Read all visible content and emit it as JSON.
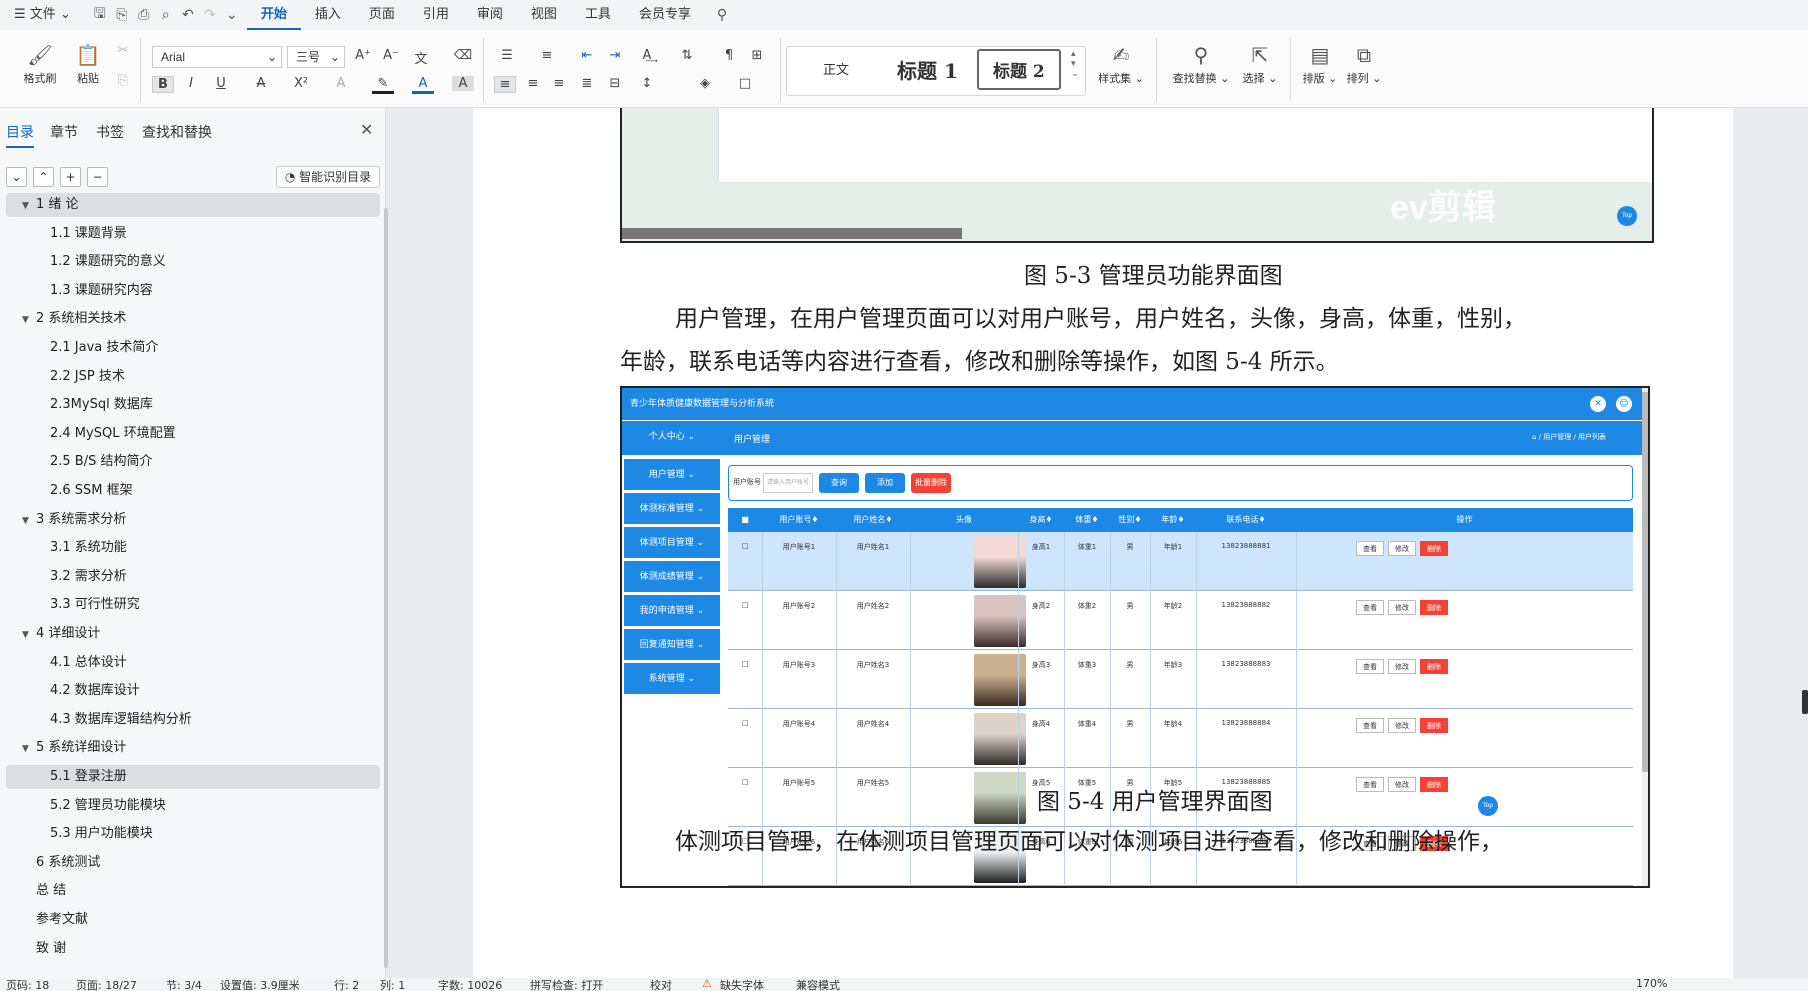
{
  "menu": {
    "file": "文件",
    "items": [
      "开始",
      "插入",
      "页面",
      "引用",
      "审阅",
      "视图",
      "工具",
      "会员专享"
    ]
  },
  "ribbon": {
    "format_painter": "格式刷",
    "paste": "粘贴",
    "font_name": "Arial",
    "font_size": "三号",
    "style_normal": "正文",
    "style_h1": "标题 1",
    "style_h2": "标题 2",
    "style_set": "样式集",
    "find_replace": "查找替换",
    "select": "选择",
    "layout": "排版",
    "arrange": "排列"
  },
  "sidebar": {
    "tabs": [
      "目录",
      "章节",
      "书签",
      "查找和替换"
    ],
    "smart_toc": "智能识别目录",
    "toc": [
      {
        "label": "1 绪 论",
        "level": 0,
        "expand": true
      },
      {
        "label": "1.1 课题背景",
        "level": 1
      },
      {
        "label": "1.2 课题研究的意义",
        "level": 1
      },
      {
        "label": "1.3 课题研究内容",
        "level": 1
      },
      {
        "label": "2 系统相关技术",
        "level": 0,
        "expand": true
      },
      {
        "label": "2.1 Java 技术简介",
        "level": 1
      },
      {
        "label": "2.2 JSP 技术",
        "level": 1
      },
      {
        "label": "2.3MySql 数据库",
        "level": 1
      },
      {
        "label": "2.4 MySQL 环境配置",
        "level": 1
      },
      {
        "label": "2.5 B/S 结构简介",
        "level": 1
      },
      {
        "label": "2.6 SSM 框架",
        "level": 1
      },
      {
        "label": "3 系统需求分析",
        "level": 0,
        "expand": true
      },
      {
        "label": "3.1 系统功能",
        "level": 1
      },
      {
        "label": "3.2  需求分析",
        "level": 1
      },
      {
        "label": "3.3 可行性研究",
        "level": 1
      },
      {
        "label": "4 详细设计",
        "level": 0,
        "expand": true
      },
      {
        "label": "4.1 总体设计",
        "level": 1
      },
      {
        "label": "4.2  数据库设计",
        "level": 1
      },
      {
        "label": "4.3 数据库逻辑结构分析",
        "level": 1
      },
      {
        "label": "5  系统详细设计",
        "level": 0,
        "expand": true
      },
      {
        "label": "5.1 登录注册",
        "level": 1,
        "selected": true
      },
      {
        "label": "5.2 管理员功能模块",
        "level": 1
      },
      {
        "label": "5.3 用户功能模块",
        "level": 1
      },
      {
        "label": "6  系统测试",
        "level": 0
      },
      {
        "label": "总    结",
        "level": 0
      },
      {
        "label": "参考文献",
        "level": 0
      },
      {
        "label": "致    谢",
        "level": 0
      }
    ]
  },
  "doc": {
    "fig3_watermark": "ev剪辑",
    "fig3_top_badge": "Top",
    "fig3_caption": "图 5-3 管理员功能界面图",
    "para1_line1": "用户管理，在用户管理页面可以对用户账号，用户姓名，头像，身高，体重，性别，",
    "para1_line2": "年龄，联系电话等内容进行查看，修改和删除等操作，如图 5-4 所示。",
    "fig4_caption": "图 5-4 用户管理界面图",
    "para2_line1": "体测项目管理，在体测项目管理页面可以对体测项目进行查看，修改和删除操作，"
  },
  "fig4": {
    "title": "青少年体质健康数据管理与分析系统",
    "nav": [
      "个人中心",
      "用户管理",
      "体测标准管理",
      "体测项目管理",
      "体测成绩管理",
      "我的申请管理",
      "回复通知管理",
      "系统管理"
    ],
    "crumb": "用户管理",
    "crumb_right": "⌂ / 用户管理 / 用户列表",
    "search_label": "用户账号",
    "search_placeholder": "请输入用户账号",
    "btn_search": "查询",
    "btn_add": "添加",
    "btn_batch_delete": "批量删除",
    "headers": [
      "用户账号",
      "用户姓名",
      "头像",
      "身高",
      "体重",
      "性别",
      "年龄",
      "联系电话",
      "操作"
    ],
    "rows": [
      [
        "用户账号1",
        "用户姓名1",
        "身高1",
        "体重1",
        "男",
        "年龄1",
        "13823888881"
      ],
      [
        "用户账号2",
        "用户姓名2",
        "身高2",
        "体重2",
        "男",
        "年龄2",
        "13823888882"
      ],
      [
        "用户账号3",
        "用户姓名3",
        "身高3",
        "体重3",
        "男",
        "年龄3",
        "13823888883"
      ],
      [
        "用户账号4",
        "用户姓名4",
        "身高4",
        "体重4",
        "男",
        "年龄4",
        "13823888884"
      ],
      [
        "用户账号5",
        "用户姓名5",
        "身高5",
        "体重5",
        "男",
        "年龄5",
        "13823888885"
      ],
      [
        "用户账号6",
        "用户姓名6",
        "身高6",
        "体重6",
        "男",
        "年龄6",
        "13823888886"
      ]
    ],
    "actions": [
      "查看",
      "修改",
      "删除"
    ],
    "top_badge": "Top"
  },
  "status": {
    "page": "页码: 18",
    "pages": "页面: 18/27",
    "section": "节: 3/4",
    "setting": "设置值: 3.9厘米",
    "row": "行: 2",
    "col": "列: 1",
    "words": "字数: 10026",
    "spell": "拼写检查: 打开",
    "proof": "校对",
    "missing_font": "缺失字体",
    "compat": "兼容模式",
    "zoom": "170%"
  }
}
